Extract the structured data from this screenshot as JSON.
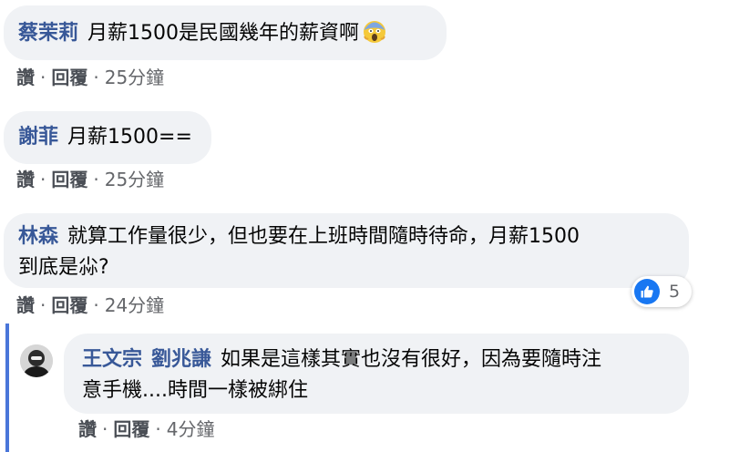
{
  "comments": [
    {
      "author": "蔡茉莉",
      "text": "月薪1500是民國幾年的薪資啊",
      "emoji": "screaming-face-emoji",
      "actions": {
        "like": "讚",
        "dot1": "·",
        "reply": "回覆",
        "dot2": "·",
        "time": "25分鐘"
      }
    },
    {
      "author": "謝菲",
      "text": "月薪1500==",
      "actions": {
        "like": "讚",
        "dot1": "·",
        "reply": "回覆",
        "dot2": "·",
        "time": "25分鐘"
      }
    },
    {
      "author": "林森",
      "text_line1": "就算工作量很少，但也要在上班時間隨時待命，月薪1500",
      "text_line2": "到底是尛?",
      "actions": {
        "like": "讚",
        "dot1": "·",
        "reply": "回覆",
        "dot2": "·",
        "time": "24分鐘"
      },
      "reaction": {
        "icon": "like-icon",
        "count": "5",
        "color": "#1877f2"
      }
    }
  ],
  "reply": {
    "author": "王文宗",
    "tagged": "劉兆謙",
    "text_line1": "如果是這樣其實也沒有很好，因為要隨時注",
    "text_line2": "意手機....時間一樣被綁住",
    "actions": {
      "like": "讚",
      "dot1": "·",
      "reply": "回覆",
      "dot2": "·",
      "time": "4分鐘"
    }
  },
  "colors": {
    "author_link": "#385898",
    "bubble": "#f0f2f5",
    "thread_line": "#4a76d9",
    "like_blue": "#1877f2"
  }
}
